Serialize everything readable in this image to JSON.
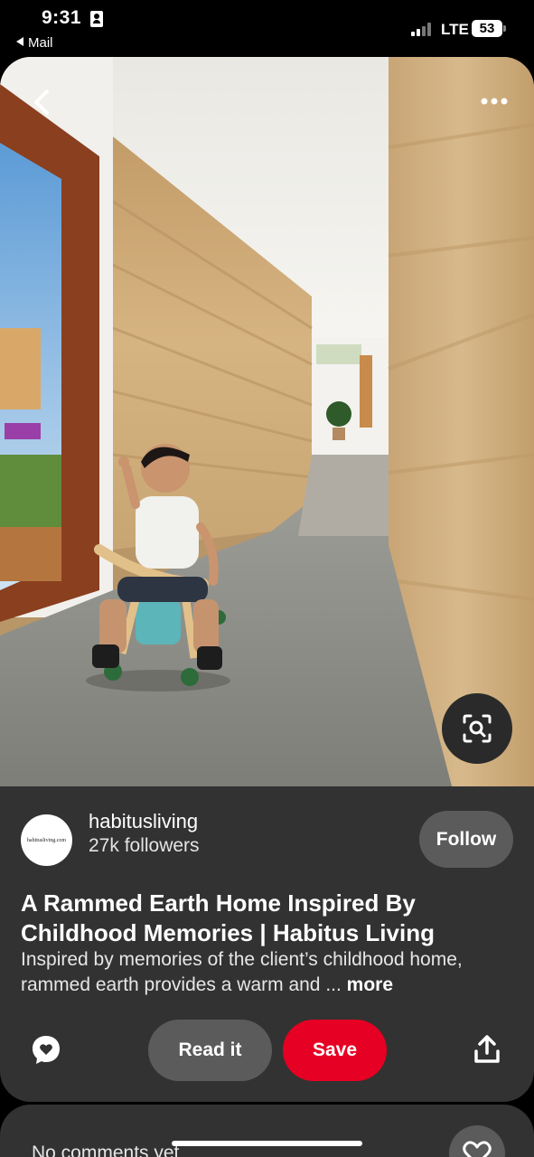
{
  "status_bar": {
    "time": "9:31",
    "back_app": "Mail",
    "network": "LTE",
    "battery": "53"
  },
  "pin": {
    "creator": {
      "avatar_text": "habitusliving.com",
      "name": "habitusliving",
      "followers": "27k followers",
      "follow_label": "Follow"
    },
    "title": "A Rammed Earth Home Inspired By Childhood Memories | Habitus Living",
    "description": "Inspired by memories of the client’s childhood home, rammed earth provides a warm and ...",
    "more_label": "more",
    "actions": {
      "read_label": "Read it",
      "save_label": "Save"
    }
  },
  "comments": {
    "empty_text": "No comments yet"
  },
  "colors": {
    "save": "#e60023",
    "card_bg": "#323232",
    "pill_bg": "#5b5b5b"
  },
  "icons": [
    "id-card-icon",
    "back-arrow-icon",
    "more-dots-icon",
    "visual-search-icon",
    "comment-icon",
    "share-icon",
    "heart-icon",
    "signal-icon",
    "battery-icon"
  ]
}
